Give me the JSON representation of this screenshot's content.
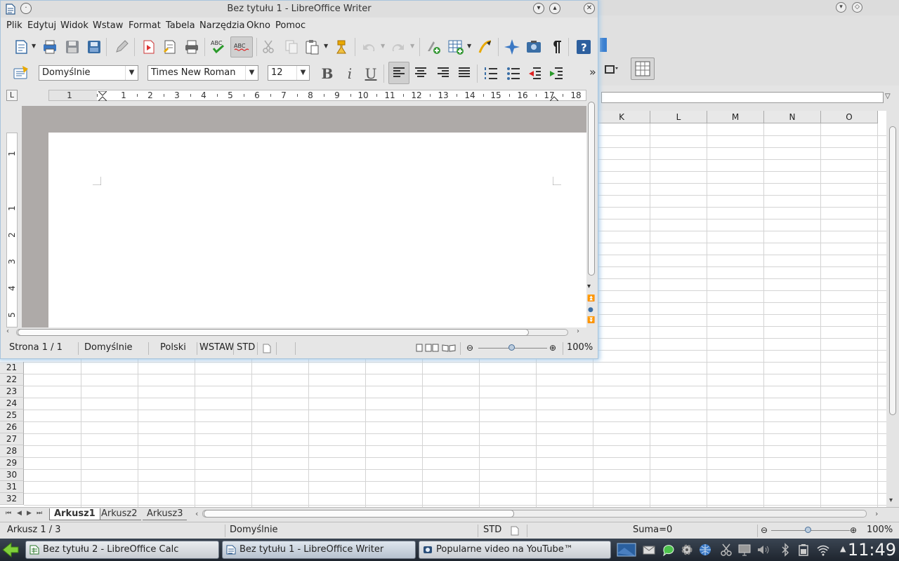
{
  "calc": {
    "columns": [
      "K",
      "L",
      "M",
      "N",
      "O"
    ],
    "rows": [
      "21",
      "22",
      "23",
      "24",
      "25",
      "26",
      "27",
      "28",
      "29",
      "30",
      "31",
      "32"
    ],
    "sheets": [
      "Arkusz1",
      "Arkusz2",
      "Arkusz3"
    ],
    "status": {
      "sheet": "Arkusz 1 / 3",
      "style": "Domyślnie",
      "mode": "STD",
      "sum": "Suma=0",
      "zoom": "100%"
    }
  },
  "writer": {
    "title": "Bez tytułu 1 - LibreOffice Writer",
    "menu": [
      "Plik",
      "Edytuj",
      "Widok",
      "Wstaw",
      "Format",
      "Tabela",
      "Narzędzia",
      "Okno",
      "Pomoc"
    ],
    "paragraph_style": "Domyślnie",
    "font_name": "Times New Roman",
    "font_size": "12",
    "overflow": "»",
    "ruler_numbers": [
      "1",
      "1",
      "2",
      "3",
      "4",
      "5",
      "6",
      "7",
      "8",
      "9",
      "10",
      "11",
      "12",
      "13",
      "14",
      "15",
      "16",
      "17",
      "18"
    ],
    "vruler_numbers": [
      "1",
      "1",
      "2",
      "3",
      "4",
      "5"
    ],
    "ruler_corner": "L",
    "status": {
      "page": "Strona 1 / 1",
      "style": "Domyślnie",
      "language": "Polski",
      "insert_mode": "WSTAW",
      "selection_mode": "STD",
      "zoom": "100%"
    }
  },
  "taskbar": {
    "tasks": [
      {
        "label": "Bez tytułu 2 - LibreOffice Calc"
      },
      {
        "label": "Bez tytułu 1 - LibreOffice Writer"
      },
      {
        "label": "Popularne video na YouTube™"
      }
    ],
    "clock": "11:49"
  }
}
